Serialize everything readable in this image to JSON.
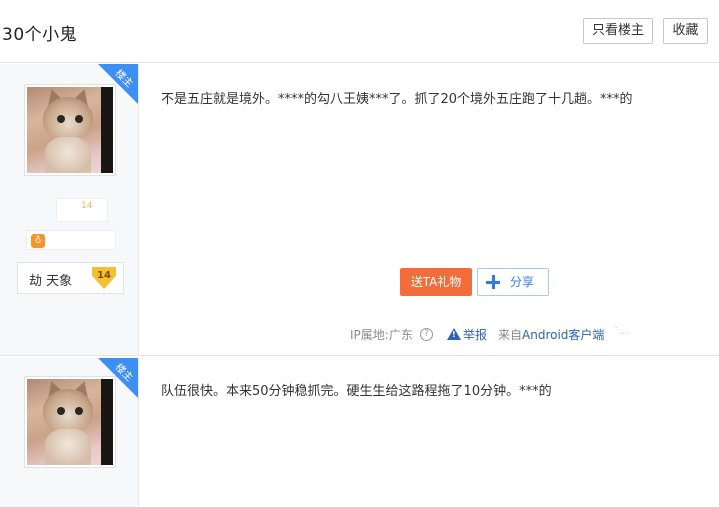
{
  "header": {
    "title": "30个小鬼",
    "only_op_button": "只看楼主",
    "favorite_button": "收藏"
  },
  "posts": [
    {
      "badge": "楼主",
      "avatar_alt": "cat-avatar",
      "level_faded": "14",
      "user_name": "劫 天象",
      "user_level": "14",
      "content": "不是五庄就是境外。****的勾八王姨***了。抓了20个境外五庄跑了十几趟。***的",
      "gift_button": "送TA礼物",
      "share_button": "分享",
      "ip_location": "IP属地:广东",
      "help_icon": "?",
      "report_label": "举报",
      "client_prefix": "来自",
      "client_name": "Android客户端",
      "faded_trail": "`..."
    },
    {
      "badge": "楼主",
      "content": "队伍很快。本来50分钟稳抓完。硬生生给这路程拖了10分钟。***的"
    }
  ],
  "colors": {
    "accent": "#3d8ff2",
    "gift": "#f36d3b",
    "link": "#2d64b3",
    "level_gold": "#f4c033"
  }
}
